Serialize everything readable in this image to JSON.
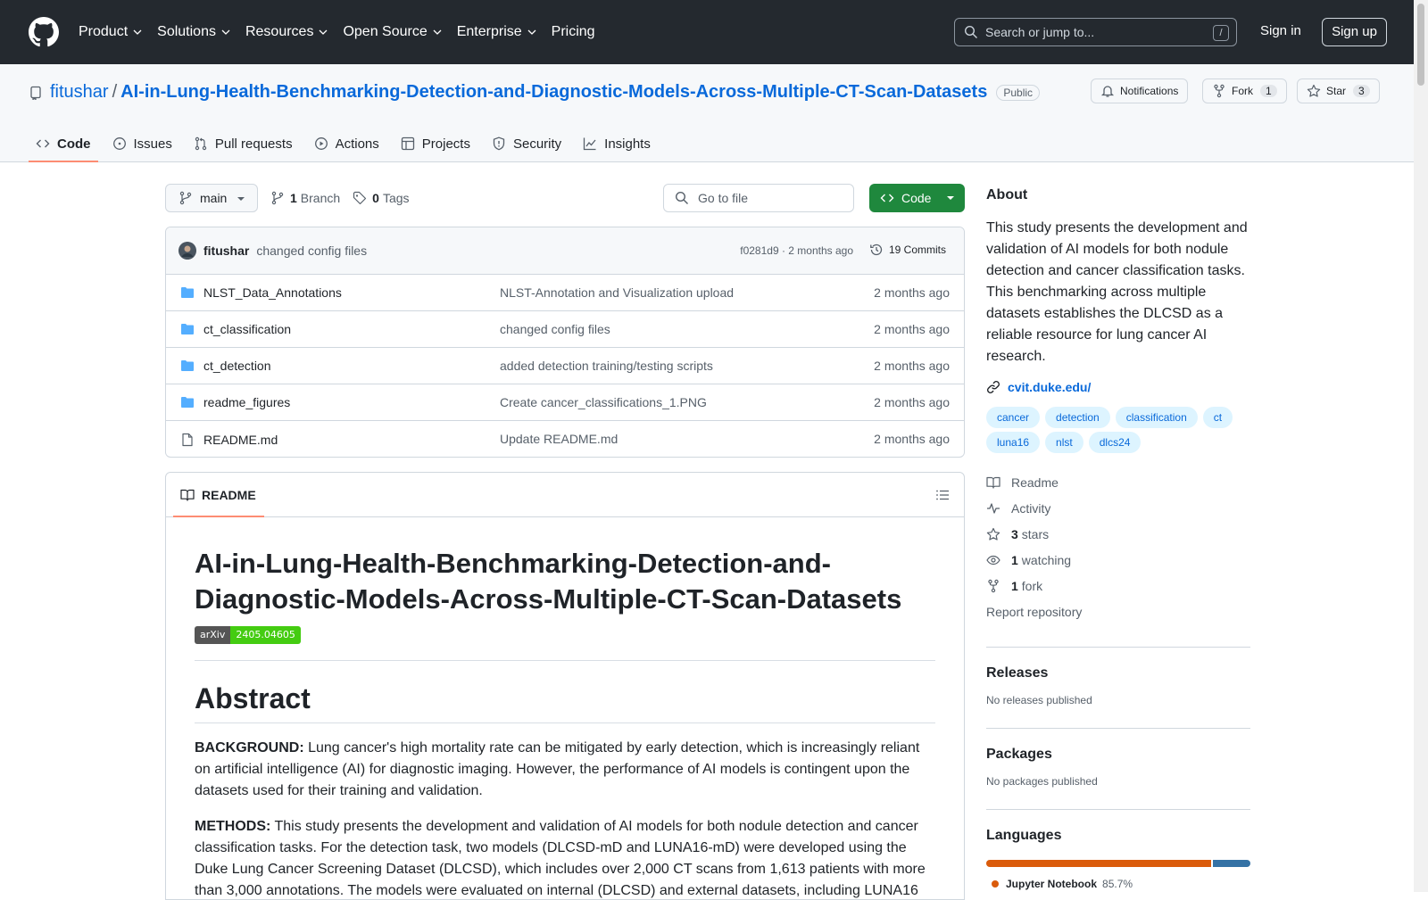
{
  "header": {
    "nav": [
      "Product",
      "Solutions",
      "Resources",
      "Open Source",
      "Enterprise",
      "Pricing"
    ],
    "search_placeholder": "Search or jump to...",
    "search_kbd": "/",
    "signin": "Sign in",
    "signup": "Sign up"
  },
  "repo": {
    "owner": "fitushar",
    "sep": "/",
    "name": "AI-in-Lung-Health-Benchmarking-Detection-and-Diagnostic-Models-Across-Multiple-CT-Scan-Datasets",
    "visibility": "Public",
    "notifications": "Notifications",
    "fork": "Fork",
    "fork_count": "1",
    "star": "Star",
    "star_count": "3"
  },
  "tabs": [
    "Code",
    "Issues",
    "Pull requests",
    "Actions",
    "Projects",
    "Security",
    "Insights"
  ],
  "toolbar": {
    "branch": "main",
    "branch_count": "1",
    "branch_label": "Branch",
    "tag_count": "0",
    "tag_label": "Tags",
    "goto_file": "Go to file",
    "code_btn": "Code"
  },
  "commit": {
    "author": "fitushar",
    "message": "changed config files",
    "meta": "f0281d9 · 2 months ago",
    "commits": "19 Commits"
  },
  "files": [
    {
      "name": "NLST_Data_Annotations",
      "type": "folder",
      "msg": "NLST-Annotation and Visualization upload",
      "age": "2 months ago"
    },
    {
      "name": "ct_classification",
      "type": "folder",
      "msg": "changed config files",
      "age": "2 months ago"
    },
    {
      "name": "ct_detection",
      "type": "folder",
      "msg": "added detection training/testing scripts",
      "age": "2 months ago"
    },
    {
      "name": "readme_figures",
      "type": "folder",
      "msg": "Create cancer_classifications_1.PNG",
      "age": "2 months ago"
    },
    {
      "name": "README.md",
      "type": "file",
      "msg": "Update README.md",
      "age": "2 months ago"
    }
  ],
  "readme": {
    "tab": "README",
    "title": "AI-in-Lung-Health-Benchmarking-Detection-and-Diagnostic-Models-Across-Multiple-CT-Scan-Datasets",
    "badge_left": "arXiv",
    "badge_right": "2405.04605",
    "abstract_heading": "Abstract",
    "p1_label": "BACKGROUND:",
    "p1_text": " Lung cancer's high mortality rate can be mitigated by early detection, which is increasingly reliant on artificial intelligence (AI) for diagnostic imaging. However, the performance of AI models is contingent upon the datasets used for their training and validation.",
    "p2_label": "METHODS:",
    "p2_text": " This study presents the development and validation of AI models for both nodule detection and cancer classification tasks. For the detection task, two models (DLCSD-mD and LUNA16-mD) were developed using the Duke Lung Cancer Screening Dataset (DLCSD), which includes over 2,000 CT scans from 1,613 patients with more than 3,000 annotations. The models were evaluated on internal (DLCSD) and external datasets, including LUNA16"
  },
  "about": {
    "heading": "About",
    "description": "This study presents the development and validation of AI models for both nodule detection and cancer classification tasks. This benchmarking across multiple datasets establishes the DLCSD as a reliable resource for lung cancer AI research.",
    "link": "cvit.duke.edu/",
    "topics": [
      "cancer",
      "detection",
      "classification",
      "ct",
      "luna16",
      "nlst",
      "dlcs24"
    ],
    "readme": "Readme",
    "activity": "Activity",
    "stars_count": "3",
    "stars_label": "stars",
    "watching_count": "1",
    "watching_label": "watching",
    "fork_count": "1",
    "fork_label": "fork",
    "report": "Report repository"
  },
  "releases": {
    "heading": "Releases",
    "text": "No releases published"
  },
  "packages": {
    "heading": "Packages",
    "text": "No packages published"
  },
  "languages": {
    "heading": "Languages",
    "bar": [
      {
        "color": "#da5b0b",
        "pct": 85.7
      },
      {
        "color": "#3572a5",
        "pct": 14.3
      }
    ],
    "first_name": "Jupyter Notebook",
    "first_pct": "85.7%"
  },
  "colors": {
    "accent": "#0969da",
    "green": "#1f883d",
    "tab_underline": "#fd8c73"
  }
}
